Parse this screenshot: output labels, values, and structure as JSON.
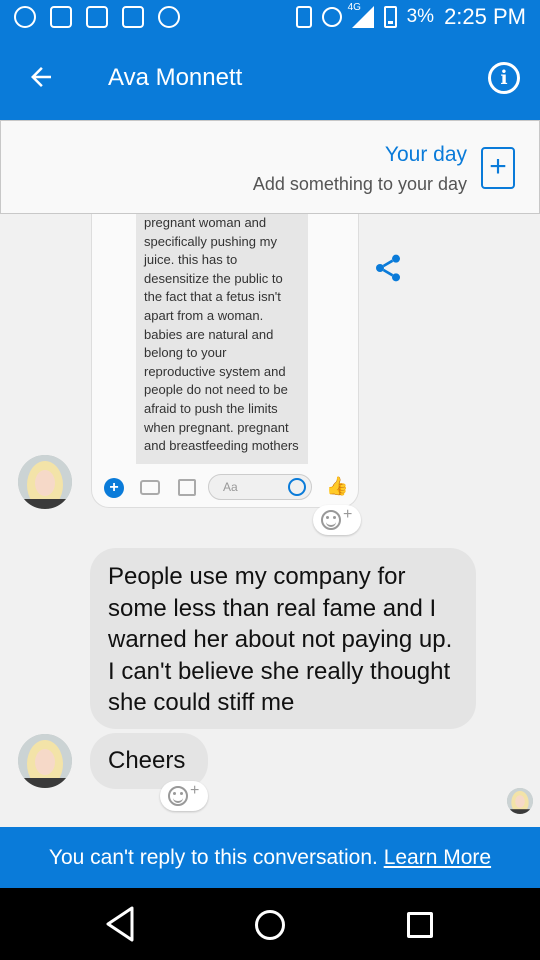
{
  "status_bar": {
    "network": "4G",
    "battery": "3%",
    "time": "2:25 PM",
    "icons": [
      "alarm-icon",
      "image-icon",
      "messenger-icon",
      "sd-card-icon",
      "chat-bubble-icon",
      "vibrate-icon",
      "alarm-icon",
      "signal-icon",
      "battery-charging-icon"
    ]
  },
  "header": {
    "title": "Ava Monnett",
    "back_icon": "arrow-left-icon",
    "info_icon": "info-icon"
  },
  "your_day": {
    "title": "Your day",
    "subtitle": "Add something to your day",
    "add_icon": "add-box-icon"
  },
  "shared_note_text": "pregnant woman and specifically pushing my juice. this has to desensitize the public to the fact that a fetus isn't apart from a woman. babies are natural and belong to your reproductive system and people do not need to be afraid to push the limits when pregnant. pregnant and breastfeeding mothers",
  "shared_card_toolbar": {
    "input_placeholder": "Aa"
  },
  "messages": [
    {
      "text": "People use my company for some less than real fame and I warned her about not paying up. I can't believe she really thought she could stiff me"
    },
    {
      "text": "Cheers"
    }
  ],
  "footer": {
    "notice": "You can't reply to this conversation.",
    "link": "Learn More"
  },
  "colors": {
    "brand_blue": "#0a7bd9",
    "bubble_gray": "#e4e4e4",
    "background": "#f1f1f1"
  }
}
